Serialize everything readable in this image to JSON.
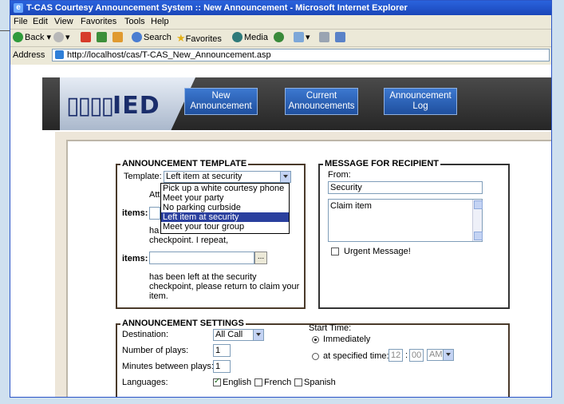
{
  "window": {
    "title": "T-CAS Courtesy Announcement System :: New Announcement - Microsoft Internet Explorer"
  },
  "menu": [
    "File",
    "Edit",
    "View",
    "Favorites",
    "Tools",
    "Help"
  ],
  "toolbar": {
    "back": "Back",
    "search": "Search",
    "favorites": "Favorites",
    "media": "Media"
  },
  "address": {
    "label": "Address",
    "url": "http://localhost/cas/T-CAS_New_Announcement.asp"
  },
  "banner": {
    "logo": "IED",
    "nav": [
      {
        "line1": "New",
        "line2": "Announcement"
      },
      {
        "line1": "Current",
        "line2": "Announcements"
      },
      {
        "line1": "Announcement",
        "line2": "Log"
      }
    ]
  },
  "template_section": {
    "title": "ANNOUNCEMENT TEMPLATE",
    "template_label": "Template:",
    "template_value": "Left item at security",
    "dropdown_options": [
      "Pick up a white courtesy phone",
      "Meet your party",
      "No parking curbside",
      "Left item at security",
      "Meet your tour group"
    ],
    "selected_index": 3,
    "attention_partial": "Atte",
    "items_label_1": "items:",
    "has_partial": "ha",
    "checkpoint_repeat": "checkpoint. I repeat,",
    "items_label_2": "items:",
    "ellipsis": "...",
    "closing_text_1": "has been left at the security",
    "closing_text_2": "checkpoint, please return to claim your",
    "closing_text_3": "item."
  },
  "recipient_section": {
    "title": "MESSAGE FOR RECIPIENT",
    "from_label": "From:",
    "from_value": "Security",
    "message": "Claim item",
    "urgent_label": "Urgent Message!"
  },
  "settings_section": {
    "title": "ANNOUNCEMENT SETTINGS",
    "destination_label": "Destination:",
    "destination_value": "All Call",
    "plays_label": "Number of plays:",
    "plays_value": "1",
    "minutes_label": "Minutes between plays:",
    "minutes_value": "1",
    "languages_label": "Languages:",
    "languages": [
      {
        "name": "English",
        "checked": true
      },
      {
        "name": "French",
        "checked": false
      },
      {
        "name": "Spanish",
        "checked": false
      }
    ],
    "start_time_label": "Start Time:",
    "immediately_label": "Immediately",
    "specified_label": "at specified time:",
    "hour": "12",
    "minute": "00",
    "ampm": "AM"
  }
}
